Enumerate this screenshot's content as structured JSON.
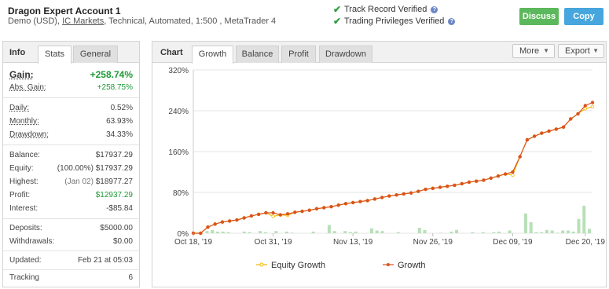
{
  "header": {
    "title": "Dragon Expert Account 1",
    "subtitle_pre": "Demo (USD), ",
    "broker": "IC Markets",
    "subtitle_post": ", Technical, Automated, 1:500 , MetaTrader 4",
    "verified": [
      "Track Record Verified",
      "Trading Privileges Verified"
    ],
    "discuss_label": "Discuss",
    "copy_label": "Copy"
  },
  "left_tabs": {
    "label": "Info",
    "tabs": [
      "Stats",
      "General"
    ]
  },
  "stats": {
    "gain": {
      "k": "Gain:",
      "v": "+258.74%"
    },
    "abs_gain": {
      "k": "Abs. Gain:",
      "v": "+258.75%"
    },
    "daily": {
      "k": "Daily:",
      "v": "0.52%"
    },
    "monthly": {
      "k": "Monthly:",
      "v": "63.93%"
    },
    "drawdown": {
      "k": "Drawdown:",
      "v": "34.33%"
    },
    "balance": {
      "k": "Balance:",
      "v": "$17937.29"
    },
    "equity": {
      "k": "Equity:",
      "note": "(100.00%)",
      "v": "$17937.29"
    },
    "highest": {
      "k": "Highest:",
      "note": "(Jan 02)",
      "v": "$18977.27"
    },
    "profit": {
      "k": "Profit:",
      "v": "$12937.29"
    },
    "interest": {
      "k": "Interest:",
      "v": "-$85.84"
    },
    "deposits": {
      "k": "Deposits:",
      "v": "$5000.00"
    },
    "withdrawals": {
      "k": "Withdrawals:",
      "v": "$0.00"
    },
    "updated": {
      "k": "Updated:",
      "v": "Feb 21 at 05:03"
    },
    "tracking": {
      "k": "Tracking",
      "v": "6"
    }
  },
  "chart_tabs": {
    "label": "Chart",
    "tabs": [
      "Growth",
      "Balance",
      "Profit",
      "Drawdown"
    ],
    "more": "More",
    "export": "Export"
  },
  "colors": {
    "growth": "#d9541e",
    "equity": "#f0b800",
    "bars": "#b8e0b8",
    "grid": "#e6e6e6"
  },
  "chart_data": {
    "type": "line",
    "ylim": [
      0,
      320
    ],
    "yticks": [
      "0%",
      "80%",
      "160%",
      "240%",
      "320%"
    ],
    "xticks": [
      "Oct 18, '19",
      "Oct 31, '19",
      "Nov 13, '19",
      "Nov 26, '19",
      "Dec 09, '19",
      "Dec 20, '19"
    ],
    "xtick_index": [
      0,
      11,
      22,
      33,
      44,
      54
    ],
    "series": [
      {
        "name": "Equity Growth",
        "values": [
          0,
          0,
          12,
          18,
          22,
          24,
          26,
          30,
          34,
          37,
          40,
          33,
          36,
          35,
          41,
          43,
          45,
          48,
          50,
          52,
          55,
          58,
          60,
          62,
          64,
          67,
          70,
          73,
          75,
          77,
          79,
          82,
          86,
          88,
          90,
          92,
          94,
          97,
          100,
          102,
          104,
          108,
          112,
          116,
          114,
          150,
          183,
          190,
          196,
          200,
          204,
          208,
          224,
          234,
          244,
          248
        ]
      },
      {
        "name": "Growth",
        "values": [
          0,
          0,
          12,
          18,
          22,
          24,
          26,
          30,
          34,
          37,
          40,
          40,
          36,
          38,
          41,
          43,
          45,
          48,
          50,
          52,
          55,
          58,
          60,
          62,
          64,
          67,
          70,
          73,
          75,
          77,
          79,
          82,
          86,
          88,
          90,
          92,
          94,
          97,
          100,
          102,
          104,
          108,
          112,
          116,
          120,
          150,
          183,
          190,
          196,
          200,
          204,
          208,
          224,
          234,
          250,
          256
        ]
      }
    ],
    "bars": [
      0,
      0,
      4,
      6,
      3,
      3,
      2,
      0,
      0,
      3,
      2,
      0,
      4,
      2,
      0,
      4,
      0,
      3,
      1,
      0,
      0,
      0,
      3,
      0,
      0,
      15,
      4,
      0,
      4,
      2,
      3,
      0,
      0,
      9,
      5,
      4,
      0,
      0,
      2,
      0,
      0,
      0,
      10,
      6,
      0,
      0,
      1,
      0,
      3,
      6,
      0,
      0,
      2,
      0,
      2,
      0,
      2,
      3,
      0,
      5,
      0,
      0,
      36,
      20,
      2,
      2,
      6,
      5,
      1,
      5,
      5,
      3,
      26,
      50,
      8
    ]
  }
}
